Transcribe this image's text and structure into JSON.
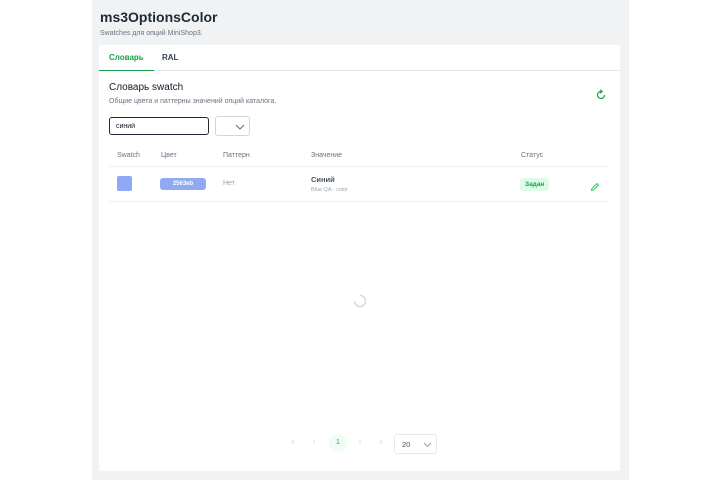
{
  "header": {
    "title": "ms3OptionsColor",
    "subtitle": "Swatches для опций MiniShop3."
  },
  "tabs": [
    {
      "label": "Словарь",
      "active": true
    },
    {
      "label": "RAL",
      "active": false
    }
  ],
  "section": {
    "title": "Словарь swatch",
    "description": "Общие цвета и паттерны значений опций каталога."
  },
  "search": {
    "value": "синий"
  },
  "table": {
    "columns": [
      "Swatch",
      "Цвет",
      "Паттерн",
      "Значение",
      "Статус"
    ],
    "rows": [
      {
        "swatch_color": "#8fa9f3",
        "color": "2563eb",
        "pattern": "Нет",
        "value_name": "Синий",
        "value_sub": "Blue QA - color",
        "status": "Задан"
      }
    ]
  },
  "pagination": {
    "current_page": "1",
    "per_page": "20"
  },
  "colors": {
    "accent": "#16a34a",
    "status_bg": "#dcfce7",
    "swatch": "#8fa9f3"
  },
  "icons": {
    "refresh": "refresh-icon",
    "edit": "pencil-icon",
    "loader": "spinner-icon",
    "dropdown": "chevron-down-icon"
  }
}
